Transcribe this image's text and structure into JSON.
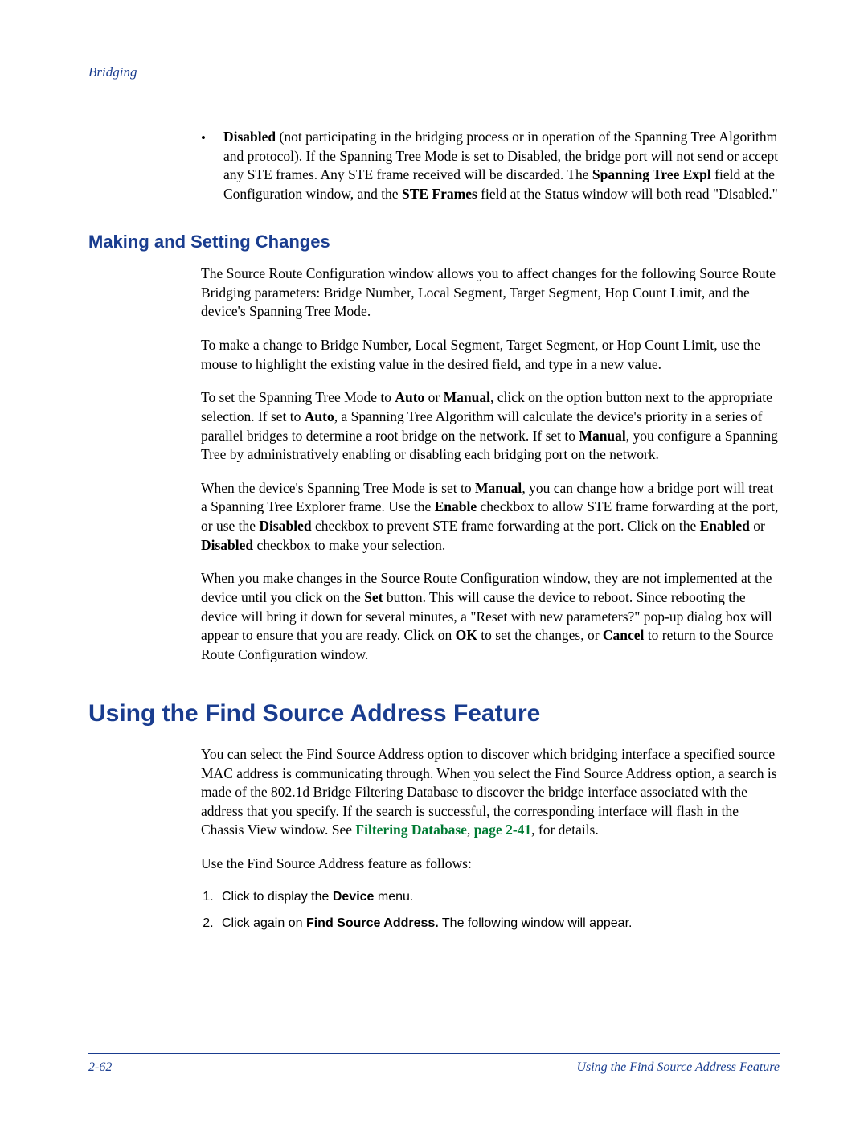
{
  "header": {
    "section": "Bridging"
  },
  "bullet": {
    "label_bold": "Disabled",
    "text": " (not participating in the bridging process or in operation of the Spanning Tree Algorithm and protocol). If the Spanning Tree Mode is set to Disabled, the bridge port will not send or accept any STE frames. Any STE frame received will be discarded. The ",
    "bold1": "Spanning Tree Expl",
    "text2": " field at the Configuration window, and the ",
    "bold2": "STE Frames",
    "text3": " field at the Status window will both read \"Disabled.\""
  },
  "h2": "Making and Setting Changes",
  "p1": "The Source Route Configuration window allows you to affect changes for the following Source Route Bridging parameters: Bridge Number, Local Segment, Target Segment, Hop Count Limit, and the device's Spanning Tree Mode.",
  "p2": "To make a change to Bridge Number, Local Segment, Target Segment, or Hop Count Limit, use the mouse to highlight the existing value in the desired field, and type in a new value.",
  "p3": {
    "a": "To set the Spanning Tree Mode to ",
    "b1": "Auto",
    "b": " or ",
    "b2": "Manual",
    "c": ", click on the option button next to the appropriate selection. If set to ",
    "b3": "Auto",
    "d": ", a Spanning Tree Algorithm will calculate the device's priority in a series of parallel bridges to determine a root bridge on the network. If set to ",
    "b4": "Manual",
    "e": ", you configure a Spanning Tree by administratively enabling or disabling each bridging port on the network."
  },
  "p4": {
    "a": "When the device's Spanning Tree Mode is set to ",
    "b1": "Manual",
    "b": ", you can change how a bridge port will treat a Spanning Tree Explorer frame. Use the ",
    "b2": "Enable",
    "c": " checkbox to allow STE frame forwarding at the port, or use the ",
    "b3": "Disabled",
    "d": " checkbox to prevent STE frame forwarding at the port. Click on the ",
    "b4": "Enabled",
    "e": " or ",
    "b5": "Disabled",
    "f": " checkbox to make your selection."
  },
  "p5": {
    "a": "When you make changes in the Source Route Configuration window, they are not implemented at the device until you click on the ",
    "b1": "Set",
    "b": " button. This will cause the device to reboot. Since rebooting the device will bring it down for several minutes, a \"Reset with new parameters?\" pop-up dialog box will appear to ensure that you are ready. Click on ",
    "b2": "OK",
    "c": " to set the changes, or ",
    "b3": "Cancel",
    "d": " to return to the Source Route Configuration window."
  },
  "h1": "Using the Find Source Address Feature",
  "p6": {
    "a": "You can select the Find Source Address option to discover which bridging interface a specified source MAC address is communicating through. When you select the Find Source Address option, a search is made of the 802.1d Bridge Filtering Database to discover the bridge interface associated with the address that you specify. If the search is successful, the corresponding interface will flash in the Chassis View window. See ",
    "link": "Filtering Database",
    "b": ", ",
    "pageref": "page 2-41",
    "c": ", for details."
  },
  "p7": "Use the Find Source Address feature as follows:",
  "steps": {
    "s1a": "Click to display the ",
    "s1b": "Device",
    "s1c": " menu.",
    "s2a": "Click again on ",
    "s2b": "Find Source Address.",
    "s2c": " The following window will appear."
  },
  "footer": {
    "page": "2-62",
    "title": "Using the Find Source Address Feature"
  }
}
